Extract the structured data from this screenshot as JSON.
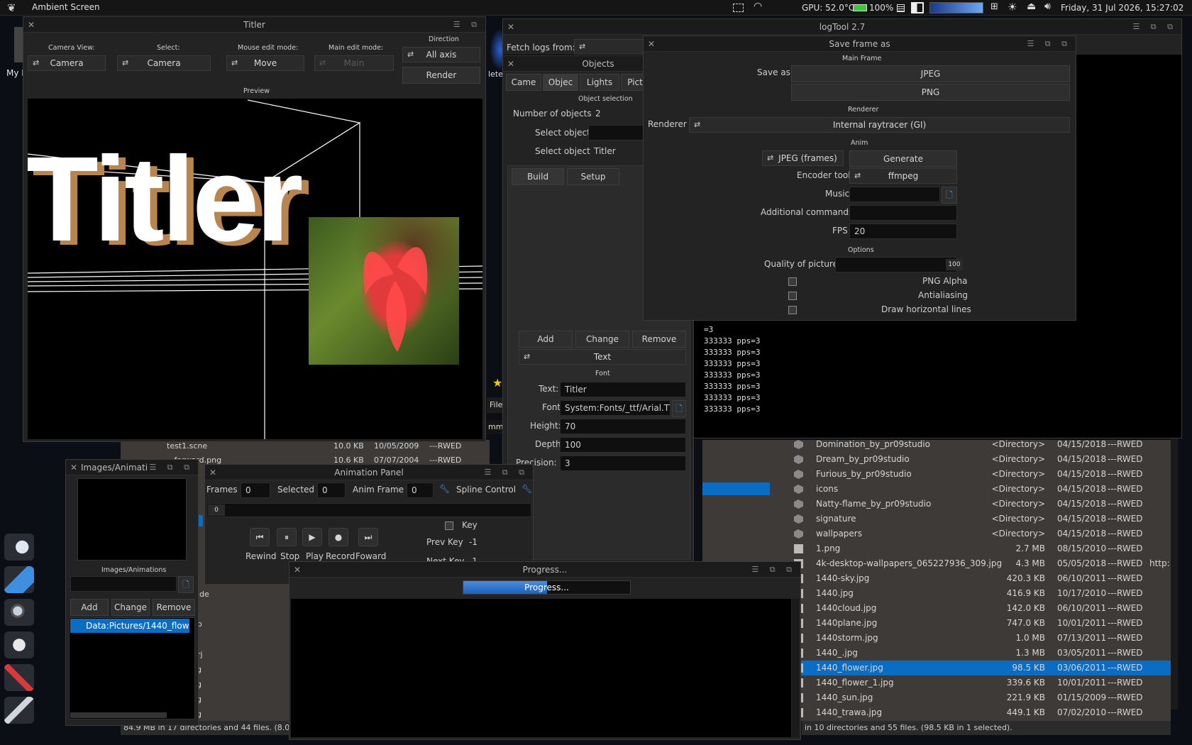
{
  "topbar": {
    "app_title": "Ambient Screen",
    "gpu": "GPU: 52.0°C",
    "battery": "100%",
    "datetime": "Friday, 31 Jul 2026, 15:27:02"
  },
  "desktop": {
    "label_my": "My I"
  },
  "titler": {
    "title": "Titler",
    "camera_view_label": "Camera View:",
    "camera_view_value": "Camera",
    "select_label": "Select:",
    "select_value": "Camera",
    "mouse_mode_label": "Mouse edit mode:",
    "mouse_mode_value": "Move",
    "main_mode_label": "Main edit mode:",
    "main_mode_value": "Main",
    "direction_label": "Direction",
    "direction_value": "All axis",
    "render_label": "Render",
    "preview_label": "Preview",
    "preview_text": "Titler"
  },
  "logtool": {
    "title": "logTool 2.7",
    "fetch_label": "Fetch logs from:",
    "lines": [
      "=3",
      "333333 pps=3",
      "333333 pps=3",
      "333333 pps=3",
      "333333 pps=3",
      "333333 pps=3",
      "333333 pps=3",
      "333333 pps=3"
    ]
  },
  "objects": {
    "title": "Objects",
    "tabs": [
      "Came",
      "Objec",
      "Lights",
      "Pict"
    ],
    "section": "Object selection",
    "num_label": "Number of objects",
    "num_value": "2",
    "select_label": "Select object",
    "select_label2": "Select object",
    "select_value2": "Titler",
    "subtabs": [
      "Build",
      "Setup"
    ],
    "add": "Add",
    "change": "Change",
    "remove": "Remove",
    "type": "Text",
    "font_section": "Font",
    "text_label": "Text:",
    "text_value": "Titler",
    "font_label": "Font",
    "font_value": "System:Fonts/_ttf/Arial.TTF",
    "height_label": "Height:",
    "height_value": "70",
    "depth_label": "Depth",
    "depth_value": "100",
    "precision_label": "Precision:",
    "precision_value": "3"
  },
  "saveframe": {
    "title": "Save frame as",
    "main_section": "Main Frame",
    "save_as_label": "Save as",
    "jpeg": "JPEG",
    "png": "PNG",
    "renderer_section": "Renderer",
    "renderer_label": "Renderer",
    "renderer_value": "Internal raytracer (GI)",
    "anim_section": "Anim",
    "anim_format": "JPEG (frames)",
    "generate": "Generate",
    "encoder_label": "Encoder tool",
    "encoder_value": "ffmpeg",
    "music_label": "Music",
    "additional_label": "Additional commands",
    "fps_label": "FPS",
    "fps_value": "20",
    "options_section": "Options",
    "quality_label": "Quality of picture",
    "quality_value": "100",
    "png_alpha": "PNG Alpha",
    "antialiasing": "Antialiasing",
    "draw_lines": "Draw horizontal lines"
  },
  "images": {
    "title": "Images/Animati",
    "section": "Images/Animations",
    "add": "Add",
    "change": "Change",
    "remove": "Remove",
    "selected_item": "Data:Pictures/1440_flower.jpg"
  },
  "animation": {
    "title": "Animation Panel",
    "frames_label": "Frames",
    "frames_value": "0",
    "selected_label": "Selected",
    "selected_value": "0",
    "animframe_label": "Anim Frame",
    "animframe_value": "0",
    "spline_label": "Spline Control",
    "slider_value": "0",
    "key_label": "Key",
    "prevkey_label": "Prev Key",
    "prevkey_value": "-1",
    "nextkey_label": "Next Key",
    "nextkey_value": "-1",
    "rewind": "Rewind",
    "stop": "Stop",
    "play": "Play",
    "record": "Record",
    "forward": "Foward"
  },
  "progress": {
    "title": "Progress...",
    "bar_text": "Progress...",
    "fraction": 0.5
  },
  "filemanager": {
    "left_status": "84.9 MB in 17 directories and 44 files. (8.0 MB in",
    "right_status": "in 10 directories and 55 files. (98.5 KB in 1 selected).",
    "left_rows": [
      {
        "name": "test1.scne",
        "size": "10.0 KB",
        "date": "10/05/2009",
        "prot": "---RWED"
      },
      {
        "name": "...forward.png",
        "size": "10.6 KB",
        "date": "07/07/2004",
        "prot": "---RWED"
      }
    ],
    "left_partial": [
      "ide",
      "o",
      "rj",
      "ng",
      "ng",
      "ng",
      "ng"
    ],
    "rows": [
      {
        "name": "Domination_by_pr09studio",
        "size": "<Directory>",
        "date": "04/15/2018",
        "prot": "---RWED"
      },
      {
        "name": "Dream_by_pr09studio",
        "size": "<Directory>",
        "date": "04/15/2018",
        "prot": "---RWED"
      },
      {
        "name": "Furious_by_pr09studio",
        "size": "<Directory>",
        "date": "04/15/2018",
        "prot": "---RWED"
      },
      {
        "name": "icons",
        "size": "<Directory>",
        "date": "04/15/2018",
        "prot": "---RWED"
      },
      {
        "name": "Natty-flame_by_pr09studio",
        "size": "<Directory>",
        "date": "04/15/2018",
        "prot": "---RWED"
      },
      {
        "name": "signature",
        "size": "<Directory>",
        "date": "04/15/2018",
        "prot": "---RWED"
      },
      {
        "name": "wallpapers",
        "size": "<Directory>",
        "date": "04/15/2018",
        "prot": "---RWED"
      },
      {
        "name": "1.png",
        "size": "2.7 MB",
        "date": "08/15/2010",
        "prot": "---RWED"
      },
      {
        "name": "4k-desktop-wallpapers_065227936_309.jpg",
        "size": "4.3 MB",
        "date": "05/05/2018",
        "prot": "---RWED"
      },
      {
        "name": "1440-sky.jpg",
        "size": "420.3 KB",
        "date": "06/10/2011",
        "prot": "---RWED"
      },
      {
        "name": "1440.jpg",
        "size": "416.9 KB",
        "date": "10/17/2010",
        "prot": "---RWED"
      },
      {
        "name": "1440cloud.jpg",
        "size": "142.0 KB",
        "date": "06/10/2011",
        "prot": "---RWED"
      },
      {
        "name": "1440plane.jpg",
        "size": "747.0 KB",
        "date": "10/01/2011",
        "prot": "---RWED"
      },
      {
        "name": "1440storm.jpg",
        "size": "1.0 MB",
        "date": "07/13/2011",
        "prot": "---RWED"
      },
      {
        "name": "1440_.jpg",
        "size": "1.3 MB",
        "date": "03/05/2011",
        "prot": "---RWED"
      },
      {
        "name": "1440_flower.jpg",
        "size": "98.5 KB",
        "date": "03/06/2011",
        "prot": "---RWED"
      },
      {
        "name": "1440_flower_1.jpg",
        "size": "339.6 KB",
        "date": "10/01/2011",
        "prot": "---RWED"
      },
      {
        "name": "1440_sun.jpg",
        "size": "221.9 KB",
        "date": "01/15/2009",
        "prot": "---RWED"
      },
      {
        "name": "1440_trawa.jpg",
        "size": "449.1 KB",
        "date": "07/02/2010",
        "prot": "---RWED"
      }
    ],
    "selected_row": 15,
    "url_fragment": "http:"
  },
  "bg_labels": {
    "file": "File",
    "mme": "mme",
    "lete": "lete"
  },
  "colors": {
    "accent": "#0a6cc2",
    "window_bg": "#232323",
    "field_bg": "#0f0f0f"
  }
}
